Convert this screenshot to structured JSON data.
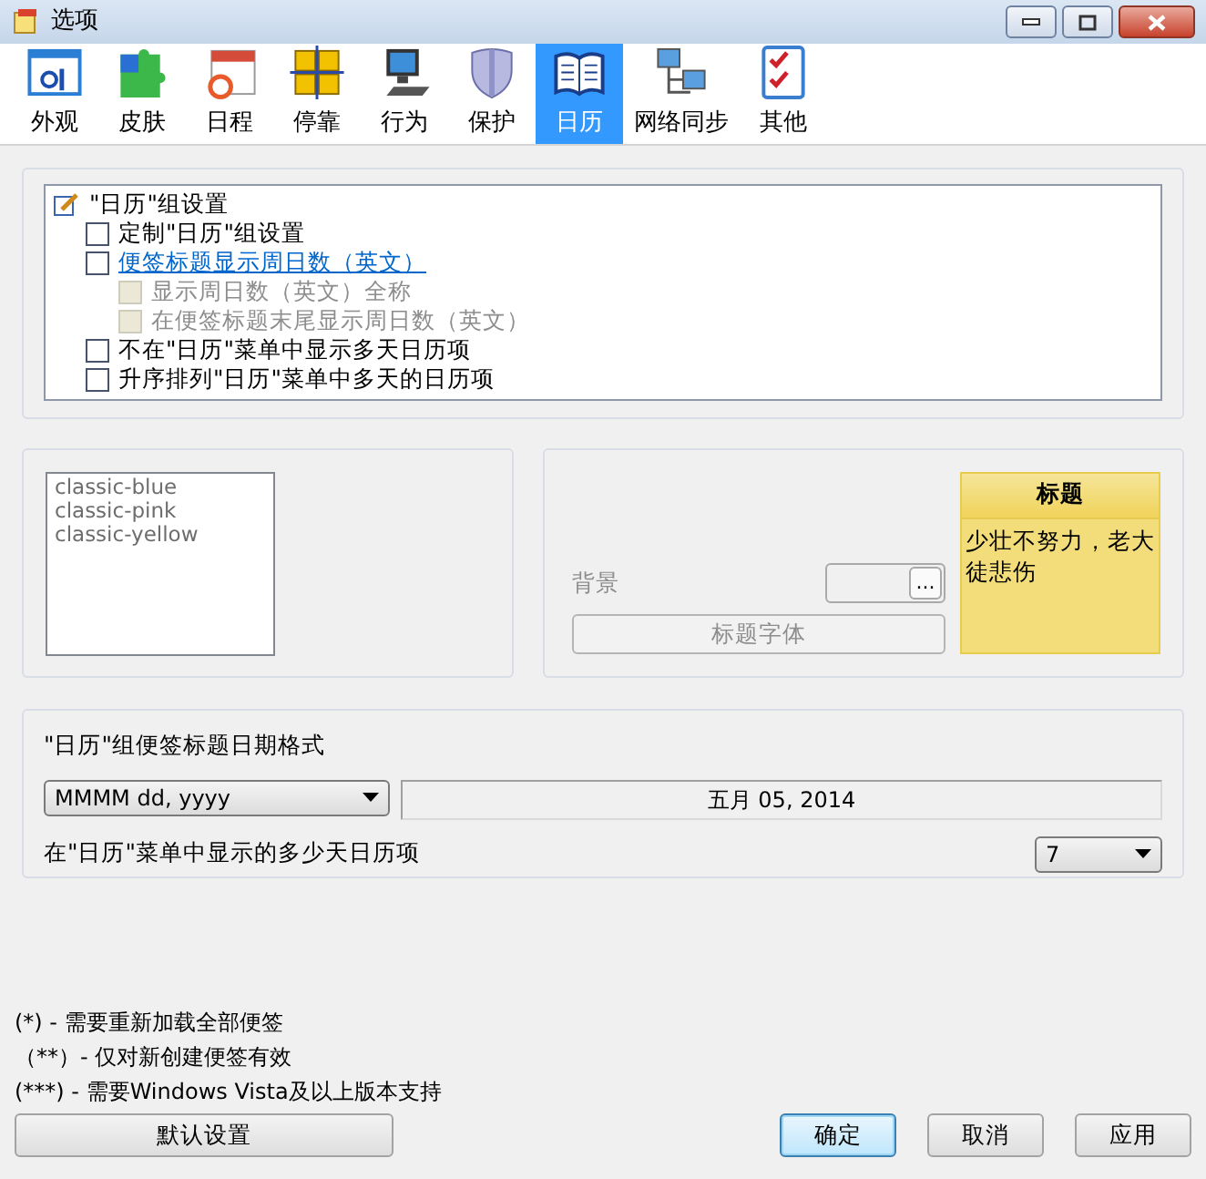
{
  "window": {
    "title": "选项"
  },
  "tabs": [
    {
      "label": "外观",
      "selected": false
    },
    {
      "label": "皮肤",
      "selected": false
    },
    {
      "label": "日程",
      "selected": false
    },
    {
      "label": "停靠",
      "selected": false
    },
    {
      "label": "行为",
      "selected": false
    },
    {
      "label": "保护",
      "selected": false
    },
    {
      "label": "日历",
      "selected": true
    },
    {
      "label": "网络同步",
      "selected": false
    },
    {
      "label": "其他",
      "selected": false
    }
  ],
  "group_settings": {
    "label": "\"日历\"组设置",
    "children": [
      {
        "label": "定制\"日历\"组设置",
        "checked": false,
        "disabled": false,
        "highlighted": false
      },
      {
        "label": "便签标题显示周日数（英文）",
        "checked": false,
        "disabled": false,
        "highlighted": true,
        "children": [
          {
            "label": "显示周日数（英文）全称",
            "checked": false,
            "disabled": true,
            "highlighted": false
          },
          {
            "label": "在便签标题末尾显示周日数（英文）",
            "checked": false,
            "disabled": true,
            "highlighted": false
          }
        ]
      },
      {
        "label": "不在\"日历\"菜单中显示多天日历项",
        "checked": false,
        "disabled": false,
        "highlighted": false
      },
      {
        "label": "升序排列\"日历\"菜单中多天的日历项",
        "checked": false,
        "disabled": false,
        "highlighted": false
      }
    ]
  },
  "skins": {
    "disabled": true,
    "items": [
      "classic-blue",
      "classic-pink",
      "classic-yellow"
    ]
  },
  "appearance": {
    "background_label": "背景",
    "browse_button": "...",
    "font_button": "标题字体",
    "disabled": true,
    "preview": {
      "title": "标题",
      "text": "少壮不努力，老大徒悲伤"
    }
  },
  "date_format": {
    "label": "\"日历\"组便签标题日期格式",
    "format": "MMMM dd, yyyy",
    "sample": "五月 05, 2014"
  },
  "days": {
    "label": "在\"日历\"菜单中显示的多少天日历项",
    "value": "7"
  },
  "notes": [
    "(*) - 需要重新加载全部便签",
    "（**）- 仅对新创建便签有效",
    "(***) - 需要Windows Vista及以上版本支持"
  ],
  "buttons": [
    {
      "label": "默认设置",
      "default": false
    },
    {
      "label": "确定",
      "default": true
    },
    {
      "label": "取消",
      "default": false
    },
    {
      "label": "应用",
      "default": false
    }
  ]
}
